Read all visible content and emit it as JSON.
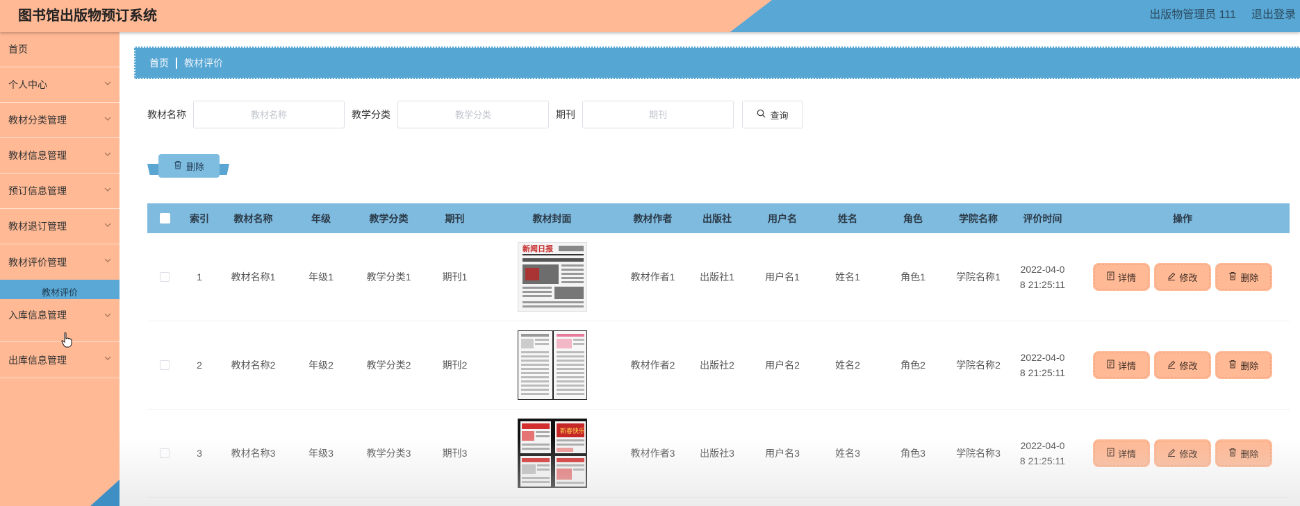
{
  "app": {
    "title": "图书馆出版物预订系统",
    "user_label": "出版物管理员 111",
    "logout_label": "退出登录"
  },
  "colors": {
    "header": "#ffb995",
    "accent": "#59a7d4",
    "table_head": "#7fbadf",
    "op_button": "#ffb995"
  },
  "sidebar": {
    "home": "首页",
    "items": [
      {
        "label": "个人中心"
      },
      {
        "label": "教材分类管理"
      },
      {
        "label": "教材信息管理"
      },
      {
        "label": "预订信息管理"
      },
      {
        "label": "教材退订管理"
      },
      {
        "label": "教材评价管理"
      }
    ],
    "active_sub": "教材评价",
    "items_after": [
      {
        "label": "入库信息管理"
      },
      {
        "label": "出库信息管理"
      }
    ]
  },
  "breadcrumb": {
    "home": "首页",
    "current": "教材评价"
  },
  "search": {
    "name_label": "教材名称",
    "name_placeholder": "教材名称",
    "category_label": "教学分类",
    "category_placeholder": "教学分类",
    "period_label": "期刊",
    "period_placeholder": "期刊",
    "button_label": "查询"
  },
  "toolbar": {
    "delete_label": "删除"
  },
  "table": {
    "headers": {
      "index": "索引",
      "name": "教材名称",
      "grade": "年级",
      "category": "教学分类",
      "period": "期刊",
      "cover": "教材封面",
      "author": "教材作者",
      "publisher": "出版社",
      "username": "用户名",
      "realname": "姓名",
      "role": "角色",
      "college": "学院名称",
      "time": "评价时间",
      "ops": "操作"
    },
    "ops": {
      "detail": "详情",
      "edit": "修改",
      "delete": "删除"
    },
    "rows": [
      {
        "index": "1",
        "name": "教材名称1",
        "grade": "年级1",
        "category": "教学分类1",
        "period": "期刊1",
        "author": "教材作者1",
        "publisher": "出版社1",
        "username": "用户名1",
        "realname": "姓名1",
        "role": "角色1",
        "college": "学院名称1",
        "time_l1": "2022-04-0",
        "time_l2": "8 21:25:11"
      },
      {
        "index": "2",
        "name": "教材名称2",
        "grade": "年级2",
        "category": "教学分类2",
        "period": "期刊2",
        "author": "教材作者2",
        "publisher": "出版社2",
        "username": "用户名2",
        "realname": "姓名2",
        "role": "角色2",
        "college": "学院名称2",
        "time_l1": "2022-04-0",
        "time_l2": "8 21:25:11"
      },
      {
        "index": "3",
        "name": "教材名称3",
        "grade": "年级3",
        "category": "教学分类3",
        "period": "期刊3",
        "author": "教材作者3",
        "publisher": "出版社3",
        "username": "用户名3",
        "realname": "姓名3",
        "role": "角色3",
        "college": "学院名称3",
        "time_l1": "2022-04-0",
        "time_l2": "8 21:25:11"
      }
    ]
  }
}
